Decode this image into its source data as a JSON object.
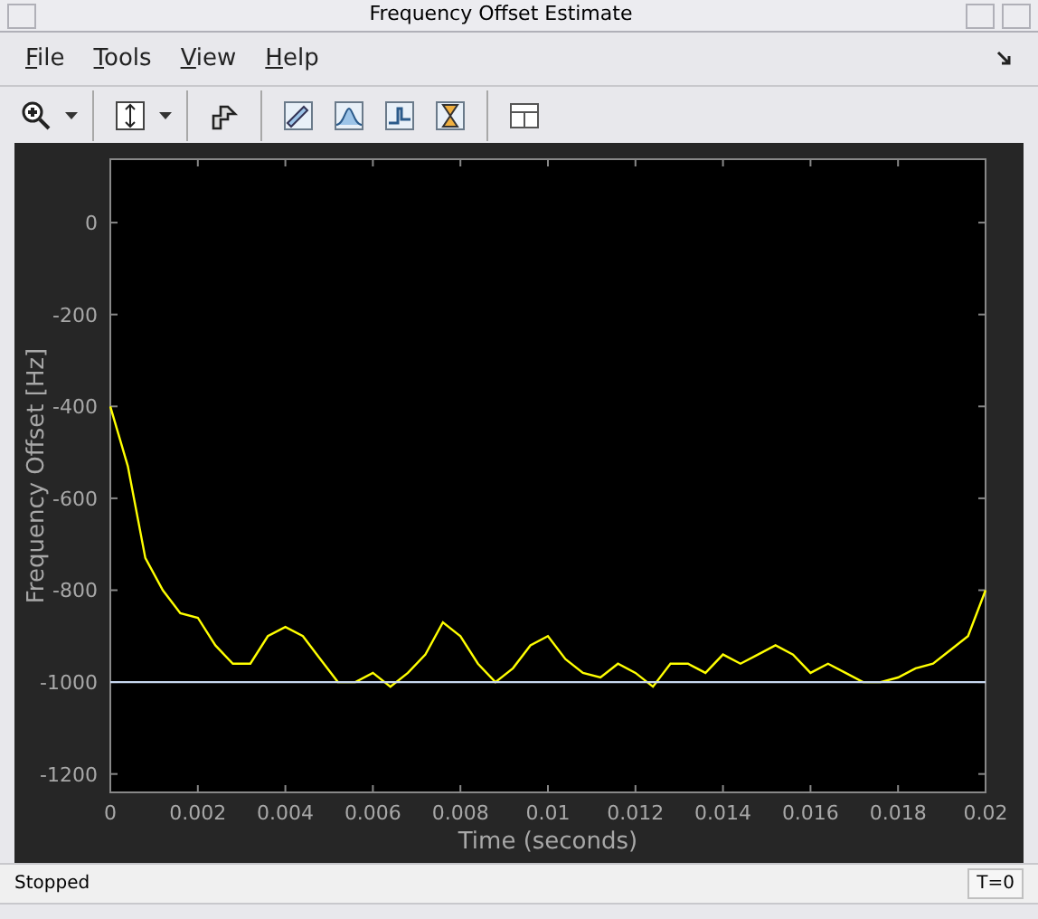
{
  "window": {
    "title": "Frequency Offset Estimate"
  },
  "menu": [
    {
      "label": "File"
    },
    {
      "label": "Tools"
    },
    {
      "label": "View"
    },
    {
      "label": "Help"
    }
  ],
  "plot": {
    "chart_data": {
      "type": "line",
      "xlabel": "Time (seconds)",
      "ylabel": "Frequency Offset [Hz]",
      "x": [
        0,
        0.0004,
        0.0008,
        0.0012,
        0.0016,
        0.002,
        0.0024,
        0.0028,
        0.0032,
        0.0036,
        0.004,
        0.0044,
        0.0048,
        0.0052,
        0.0056,
        0.006,
        0.0064,
        0.0068,
        0.0072,
        0.0076,
        0.008,
        0.0084,
        0.0088,
        0.0092,
        0.0096,
        0.01,
        0.0104,
        0.0108,
        0.0112,
        0.0116,
        0.012,
        0.0124,
        0.0128,
        0.0132,
        0.0136,
        0.014,
        0.0144,
        0.0148,
        0.0152,
        0.0156,
        0.016,
        0.0164,
        0.0168,
        0.0172,
        0.0176,
        0.018,
        0.0184,
        0.0188,
        0.0192,
        0.0196,
        0.02
      ],
      "series": [
        {
          "color": "#ffff00",
          "values": [
            -400,
            -530,
            -730,
            -800,
            -850,
            -860,
            -920,
            -960,
            -960,
            -900,
            -880,
            -900,
            -950,
            -1000,
            -1000,
            -980,
            -1010,
            -980,
            -940,
            -870,
            -900,
            -960,
            -1000,
            -970,
            -920,
            -900,
            -950,
            -980,
            -990,
            -960,
            -980,
            -1010,
            -960,
            -960,
            -980,
            -940,
            -960,
            -940,
            -920,
            -940,
            -980,
            -960,
            -980,
            -1000,
            -1000,
            -990,
            -970,
            -960,
            -930,
            -900,
            -800
          ]
        },
        {
          "color": "#c8d8f0",
          "values": [
            -1000,
            -1000,
            -1000,
            -1000,
            -1000,
            -1000,
            -1000,
            -1000,
            -1000,
            -1000,
            -1000,
            -1000,
            -1000,
            -1000,
            -1000,
            -1000,
            -1000,
            -1000,
            -1000,
            -1000,
            -1000,
            -1000,
            -1000,
            -1000,
            -1000,
            -1000,
            -1000,
            -1000,
            -1000,
            -1000,
            -1000,
            -1000,
            -1000,
            -1000,
            -1000,
            -1000,
            -1000,
            -1000,
            -1000,
            -1000,
            -1000,
            -1000,
            -1000,
            -1000,
            -1000,
            -1000,
            -1000,
            -1000,
            -1000,
            -1000,
            -1000
          ]
        }
      ],
      "xlim": [
        0,
        0.02
      ],
      "ylim": [
        -1240,
        138
      ],
      "xticks": [
        0,
        0.002,
        0.004,
        0.006,
        0.008,
        0.01,
        0.012,
        0.014,
        0.016,
        0.018,
        0.02
      ],
      "yticks": [
        0,
        -200,
        -400,
        -600,
        -800,
        -1000,
        -1200
      ]
    }
  },
  "status_bar": {
    "message": "Stopped",
    "time": "T=0"
  }
}
